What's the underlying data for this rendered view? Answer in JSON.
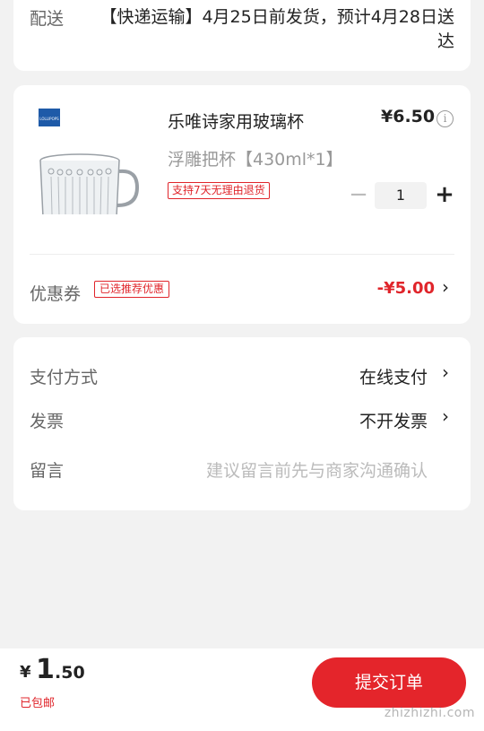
{
  "delivery": {
    "label": "配送",
    "value": "【快递运输】4月25日前发货，预计4月28日送达"
  },
  "product": {
    "title": "乐唯诗家用玻璃杯",
    "price": "¥6.50",
    "info_icon": "info-circle-icon",
    "spec": "浮雕把杯【430ml*1】",
    "return_tag": "支持7天无理由退货",
    "quantity": "1",
    "minus_icon": "minus-icon",
    "plus_icon": "plus-icon",
    "brand_logo_text": "LOLLIPOPS"
  },
  "coupon": {
    "label": "优惠券",
    "tag": "已选推荐优惠",
    "value": "-¥5.00"
  },
  "payment": {
    "rows": [
      {
        "label": "支付方式",
        "value": "在线支付"
      },
      {
        "label": "发票",
        "value": "不开发票"
      }
    ],
    "note_label": "留言",
    "note_placeholder": "建议留言前先与商家沟通确认"
  },
  "bottom": {
    "price_symbol": "¥",
    "price_int": "1",
    "price_dec": ".50",
    "shipping": "已包邮",
    "submit": "提交订单",
    "watermark": "zhizhizhi.com"
  },
  "colors": {
    "accent": "#e4252b",
    "background": "#f2f2f2"
  }
}
